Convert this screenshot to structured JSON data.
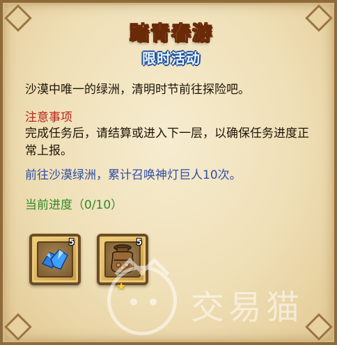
{
  "panel": {
    "title": "踏青春游",
    "subtitle": "限时活动",
    "description": "沙漠中唯一的绿洲，清明时节前往探险吧。",
    "notice_title": "注意事项",
    "notice_body": "完成任务后，请结算或进入下一层，以确保任务进度正常上报。",
    "task": "前往沙漠绿洲，累计召唤神灯巨人10次。",
    "progress": "当前进度（0/10）"
  },
  "rewards": [
    {
      "icon": "blue-crystal-icon",
      "count": "5"
    },
    {
      "icon": "bronze-jar-icon",
      "count": "5",
      "star": "★"
    }
  ],
  "watermark": {
    "text": "交易猫"
  },
  "colors": {
    "title": "#f7d24a",
    "subtitle_outline": "#1e4f9c",
    "notice": "#b8251c",
    "task": "#2f4fa8",
    "progress": "#2e8a28"
  }
}
